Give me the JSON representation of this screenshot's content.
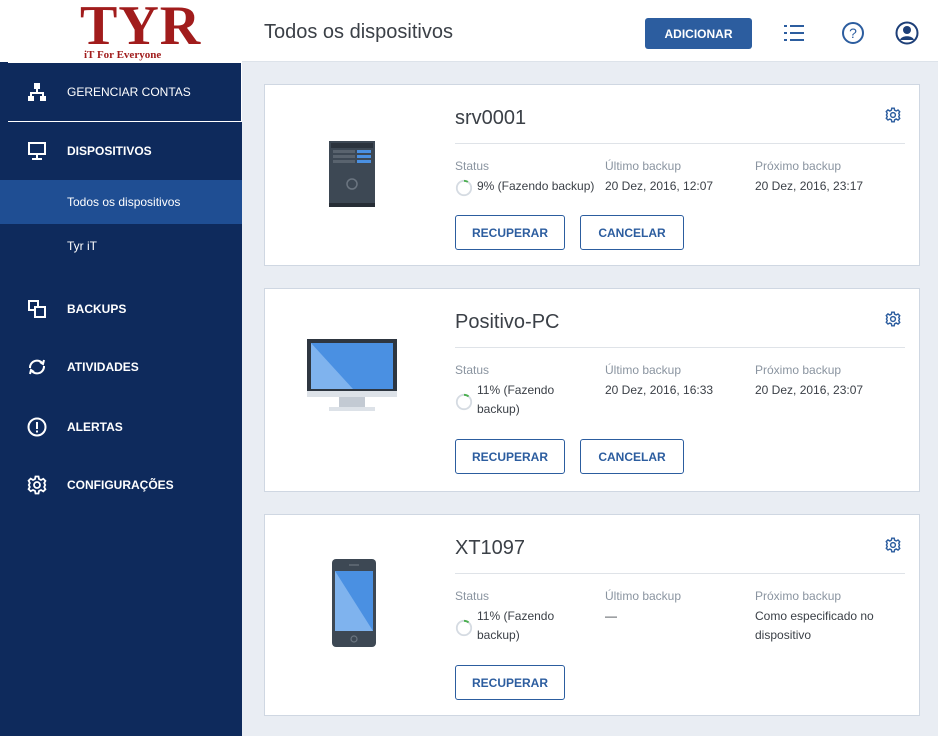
{
  "logo": {
    "text": "TYR",
    "tagline": "iT For Everyone"
  },
  "header": {
    "title": "Todos os dispositivos",
    "add_button": "ADICIONAR",
    "icons": [
      "list-icon",
      "help-icon",
      "account-icon"
    ]
  },
  "sidebar": {
    "accounts_label": "GERENCIAR CONTAS",
    "devices_label": "DISPOSITIVOS",
    "sub_items": [
      "Todos os dispositivos",
      "Tyr iT"
    ],
    "backups_label": "BACKUPS",
    "activities_label": "ATIVIDADES",
    "alerts_label": "ALERTAS",
    "settings_label": "CONFIGURAÇÕES"
  },
  "column_headers": {
    "status": "Status",
    "last_backup": "Último backup",
    "next_backup": "Próximo backup"
  },
  "devices": [
    {
      "name": "srv0001",
      "type": "server",
      "progress": 9,
      "status_line1": "9% (Fazendo backup)",
      "status_line2": "",
      "last_backup": "20 Dez, 2016, 12:07",
      "next_backup": "20 Dez, 2016, 23:17",
      "next_backup_line2": "",
      "recover_label": "RECUPERAR",
      "cancel_label": "CANCELAR"
    },
    {
      "name": "Positivo-PC",
      "type": "monitor",
      "progress": 11,
      "status_line1": "11% (Fazendo",
      "status_line2": "backup)",
      "last_backup": "20 Dez, 2016, 16:33",
      "next_backup": "20 Dez, 2016, 23:07",
      "next_backup_line2": "",
      "recover_label": "RECUPERAR",
      "cancel_label": "CANCELAR"
    },
    {
      "name": "XT1097",
      "type": "phone",
      "progress": 11,
      "status_line1": "11% (Fazendo",
      "status_line2": "backup)",
      "last_backup": "—",
      "next_backup": "Como especificado no",
      "next_backup_line2": "dispositivo",
      "recover_label": "RECUPERAR"
    }
  ],
  "colors": {
    "sidebar_bg": "#0e2a5c",
    "sidebar_active": "#1f4e93",
    "primary": "#2c5d9f",
    "progress": "#4caf50",
    "logo": "#a11c1c"
  }
}
